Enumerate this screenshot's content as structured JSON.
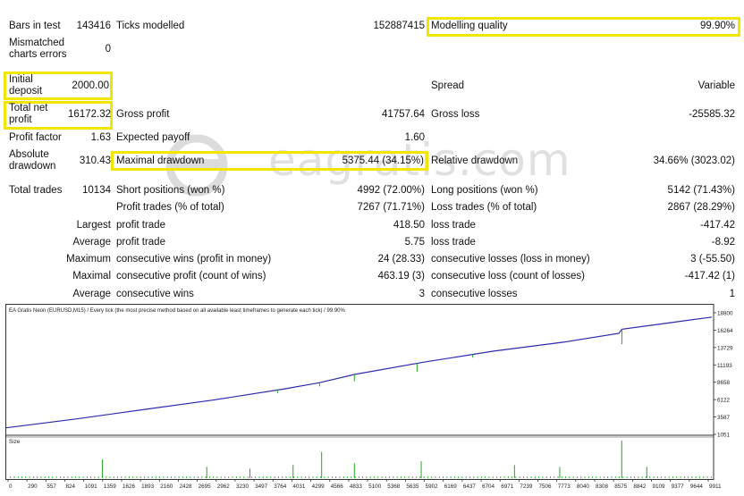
{
  "stats": {
    "bars_label": "Bars in test",
    "bars_value": "143416",
    "ticks_label": "Ticks modelled",
    "ticks_value": "152887415",
    "mq_label": "Modelling quality",
    "mq_value": "99.90%",
    "mismatch_label_1": "Mismatched",
    "mismatch_label_2": "charts errors",
    "mismatch_value": "0",
    "deposit_label_1": "Initial",
    "deposit_label_2": "deposit",
    "deposit_value": "2000.00",
    "spread_label": "Spread",
    "spread_value": "Variable",
    "netprofit_label_1": "Total net",
    "netprofit_label_2": "profit",
    "netprofit_value": "16172.32",
    "grossprofit_label": "Gross profit",
    "grossprofit_value": "41757.64",
    "grossloss_label": "Gross loss",
    "grossloss_value": "-25585.32",
    "pf_label": "Profit factor",
    "pf_value": "1.63",
    "ep_label": "Expected payoff",
    "ep_value": "1.60",
    "absdd_label_1": "Absolute",
    "absdd_label_2": "drawdown",
    "absdd_value": "310.43",
    "maxdd_label": "Maximal drawdown",
    "maxdd_value": "5375.44 (34.15%)",
    "reldd_label": "Relative drawdown",
    "reldd_value": "34.66% (3023.02)",
    "tt_label": "Total trades",
    "tt_value": "10134",
    "short_label": "Short positions (won %)",
    "short_value": "4992 (72.00%)",
    "long_label": "Long positions (won %)",
    "long_value": "5142 (71.43%)",
    "pt_label": "Profit trades (% of total)",
    "pt_value": "7267 (71.71%)",
    "lt_label": "Loss trades (% of total)",
    "lt_value": "2867 (28.29%)",
    "largest_label": "Largest",
    "lpt_label": "profit trade",
    "lpt_value": "418.50",
    "llt_label": "loss trade",
    "llt_value": "-417.42",
    "average_label": "Average",
    "apt_label": "profit trade",
    "apt_value": "5.75",
    "alt_label": "loss trade",
    "alt_value": "-8.92",
    "maximum_label": "Maximum",
    "mcw_label": "consecutive wins (profit in money)",
    "mcw_value": "24 (28.33)",
    "mcl_label": "consecutive losses (loss in money)",
    "mcl_value": "3 (-55.50)",
    "maximal_label": "Maximal",
    "mcp_label": "consecutive profit (count of wins)",
    "mcp_value": "463.19 (3)",
    "mcloss_label": "consecutive loss (count of losses)",
    "mcloss_value": "-417.42 (1)",
    "average2_label": "Average",
    "acw_label": "consecutive wins",
    "acw_value": "3",
    "acl_label": "consecutive losses",
    "acl_value": "1"
  },
  "watermark": {
    "text": "eagratis.com"
  },
  "chart_data": {
    "type": "line",
    "title": "EA Gratis Neon (EURUSD,M15) / Every tick (the most precise method based on all available least timeframes to generate each tick) / 99.90%",
    "y_ticks": [
      "18800",
      "16264",
      "13729",
      "11193",
      "8658",
      "6122",
      "3587",
      "1051"
    ],
    "ylim": [
      1051,
      18800
    ],
    "x_ticks": [
      "0",
      "290",
      "557",
      "824",
      "1091",
      "1359",
      "1626",
      "1893",
      "2160",
      "2428",
      "2695",
      "2962",
      "3230",
      "3497",
      "3764",
      "4031",
      "4299",
      "4566",
      "4833",
      "5100",
      "5368",
      "5635",
      "5902",
      "6169",
      "6437",
      "6704",
      "6971",
      "7239",
      "7506",
      "7773",
      "8040",
      "8308",
      "8575",
      "8842",
      "9109",
      "9377",
      "9644",
      "9911"
    ],
    "xlim": [
      0,
      10134
    ],
    "series": [
      {
        "values_x": [
          0,
          1000,
          2000,
          3000,
          4000,
          4500,
          5000,
          6000,
          7000,
          8000,
          8800,
          8842,
          9500,
          10134
        ],
        "values_y": [
          2000,
          3300,
          4700,
          6100,
          7700,
          8600,
          9800,
          11600,
          13200,
          14500,
          15800,
          16400,
          17300,
          18172
        ]
      }
    ],
    "size_panel": {
      "label": "Size",
      "spikes": [
        [
          1380,
          0.5
        ],
        [
          2880,
          0.3
        ],
        [
          3500,
          0.25
        ],
        [
          4120,
          0.35
        ],
        [
          4530,
          0.7
        ],
        [
          5000,
          0.4
        ],
        [
          5960,
          0.45
        ],
        [
          7300,
          0.35
        ],
        [
          7950,
          0.3
        ],
        [
          8840,
          1.0
        ],
        [
          9200,
          0.3
        ]
      ]
    },
    "colors": {
      "line": "#2b2bb0",
      "dips": "#22aa22",
      "size": "#22aa22"
    }
  }
}
